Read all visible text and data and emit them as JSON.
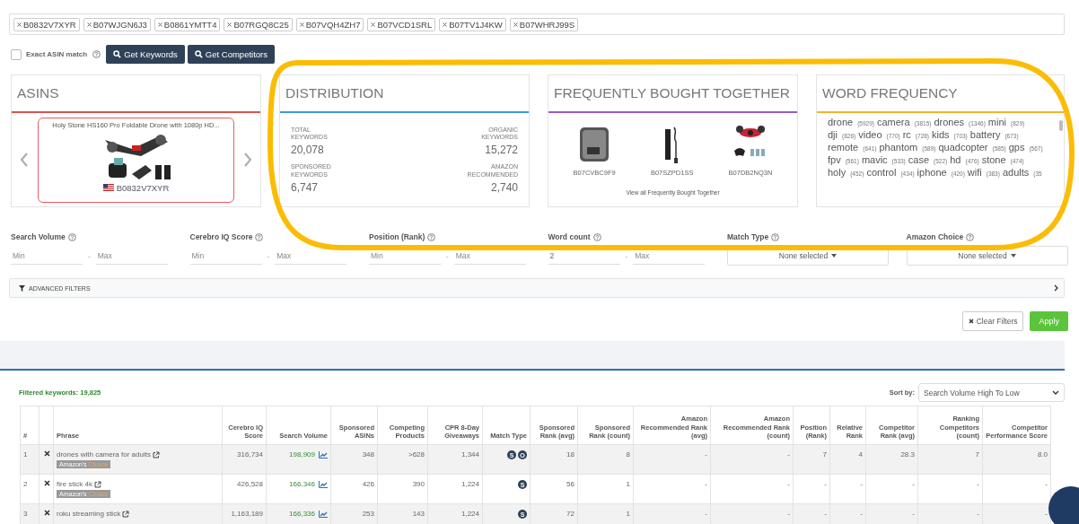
{
  "asin_tags": [
    "B0832V7XYR",
    "B07WJGN6J3",
    "B0861YMTT4",
    "B07RGQ8C25",
    "B07VQH4ZH7",
    "B07VCD1SRL",
    "B07TV1J4KW",
    "B07WHRJ99S"
  ],
  "exact_match": {
    "label": "Exact ASIN match",
    "checked": false
  },
  "buttons": [
    "Get Keywords",
    "Get Competitors"
  ],
  "asins_card": {
    "title": "ASINS",
    "product": {
      "name": "Holy Stone HS160 Pro Foldable Drone with 1080p HD...",
      "asin": "B0832V7XYR",
      "selected": true
    }
  },
  "distribution": {
    "title": "DISTRIBUTION",
    "stats": [
      {
        "label": "TOTAL KEYWORDS",
        "value": "20,078"
      },
      {
        "label": "ORGANIC KEYWORDS",
        "value": "15,272"
      },
      {
        "label": "SPONSORED KEYWORDS",
        "value": "6,747"
      },
      {
        "label": "AMAZON RECOMMENDED",
        "value": "2,740"
      }
    ]
  },
  "frequently_bought": {
    "title": "FREQUENTLY BOUGHT TOGETHER",
    "items": [
      "B07CVBC9F9",
      "B07SZPD1SS",
      "B07DB2NQ3N"
    ],
    "link": "View all Frequently Bought Together"
  },
  "word_frequency": {
    "title": "WORD FREQUENCY",
    "rows": [
      [
        {
          "word": "drone",
          "count": "(5929)"
        },
        {
          "word": "camera",
          "count": "(3815)"
        },
        {
          "word": "drones",
          "count": "(1346)"
        },
        {
          "word": "mini",
          "count": "(829)"
        }
      ],
      [
        {
          "word": "dji",
          "count": "(826)"
        },
        {
          "word": "video",
          "count": "(770)"
        },
        {
          "word": "rc",
          "count": "(728)"
        },
        {
          "word": "kids",
          "count": "(703)"
        },
        {
          "word": "battery",
          "count": "(673)"
        }
      ],
      [
        {
          "word": "remote",
          "count": "(641)"
        },
        {
          "word": "phantom",
          "count": "(589)"
        },
        {
          "word": "quadcopter",
          "count": "(585)"
        },
        {
          "word": "gps",
          "count": "(567)"
        }
      ],
      [
        {
          "word": "fpv",
          "count": "(561)"
        },
        {
          "word": "mavic",
          "count": "(533)"
        },
        {
          "word": "case",
          "count": "(522)"
        },
        {
          "word": "hd",
          "count": "(476)"
        },
        {
          "word": "stone",
          "count": "(474)"
        }
      ],
      [
        {
          "word": "holy",
          "count": "(452)"
        },
        {
          "word": "control",
          "count": "(434)"
        },
        {
          "word": "iphone",
          "count": "(420)"
        },
        {
          "word": "wifi",
          "count": "(383)"
        },
        {
          "word": "adults",
          "count": "(35"
        }
      ]
    ]
  },
  "filters": [
    {
      "label": "Search Volume",
      "kind": "range",
      "min_placeholder": "Min",
      "separator": "-",
      "max_placeholder": "Max"
    },
    {
      "label": "Cerebro IQ Score",
      "kind": "range",
      "min_placeholder": "Min",
      "separator": "-",
      "max_placeholder": "Max"
    },
    {
      "label": "Position (Rank)",
      "kind": "range",
      "min_placeholder": "Min",
      "separator": "-",
      "max_placeholder": "Max"
    },
    {
      "label": "Word count",
      "kind": "range",
      "min_value": "2",
      "separator": "-",
      "max_placeholder": "Max"
    },
    {
      "label": "Match Type",
      "kind": "select",
      "value": "None selected"
    },
    {
      "label": "Amazon Choice",
      "kind": "select",
      "value": "None selected"
    }
  ],
  "advanced_filters": "ADVANCED FILTERS",
  "actions": [
    "Clear Filters",
    "Apply"
  ],
  "filtered_keywords": "Filtered keywords: 19,825",
  "sort": {
    "label": "Sort by:",
    "value": "Search Volume High To Low"
  },
  "table": {
    "columns": [
      "#",
      "Phrase",
      "Cerebro IQ Score",
      "Search Volume",
      "Sponsored ASINs",
      "Competing Products",
      "CPR 8-Day Giveaways",
      "Match Type",
      "Sponsored Rank (avg)",
      "Sponsored Rank (count)",
      "Amazon Recommended Rank (avg)",
      "Amazon Recommended Rank (count)",
      "Position (Rank)",
      "Relative Rank",
      "Competitor Rank (avg)",
      "Ranking Competitors (count)",
      "Competitor Performance Score"
    ],
    "rows": [
      {
        "num": "1",
        "phrase": "drones with camera for adults",
        "amazons_choice": true,
        "choice_badge": [
          "Amazon's",
          "Choice"
        ],
        "cerebro": "316,734",
        "search_volume": "198,909",
        "stats_a": [
          "348",
          ">628",
          "1,344"
        ],
        "match_types": [
          "S",
          "O"
        ],
        "stats_b": [
          "18",
          "8",
          "-",
          "-",
          "7",
          "4",
          "28.3",
          "7",
          "8.0"
        ]
      },
      {
        "num": "2",
        "phrase": "fire stick 4k",
        "amazons_choice": true,
        "choice_badge": [
          "Amazon's",
          "Choice"
        ],
        "cerebro": "426,528",
        "search_volume": "166,346",
        "stats_a": [
          "426",
          "390",
          "1,224"
        ],
        "match_types": [
          "S"
        ],
        "stats_b": [
          "56",
          "1",
          "-",
          "-",
          "-",
          "-",
          "-",
          "-",
          "-"
        ]
      },
      {
        "num": "3",
        "phrase": "roku streaming stick",
        "cerebro": "1,163,189",
        "search_volume": "166,336",
        "stats_a": [
          "253",
          "143",
          "1,224"
        ],
        "match_types": [
          "S"
        ],
        "stats_b": [
          "72",
          "1",
          "-",
          "-",
          "-",
          "-",
          "-",
          "-",
          "-"
        ]
      }
    ]
  }
}
